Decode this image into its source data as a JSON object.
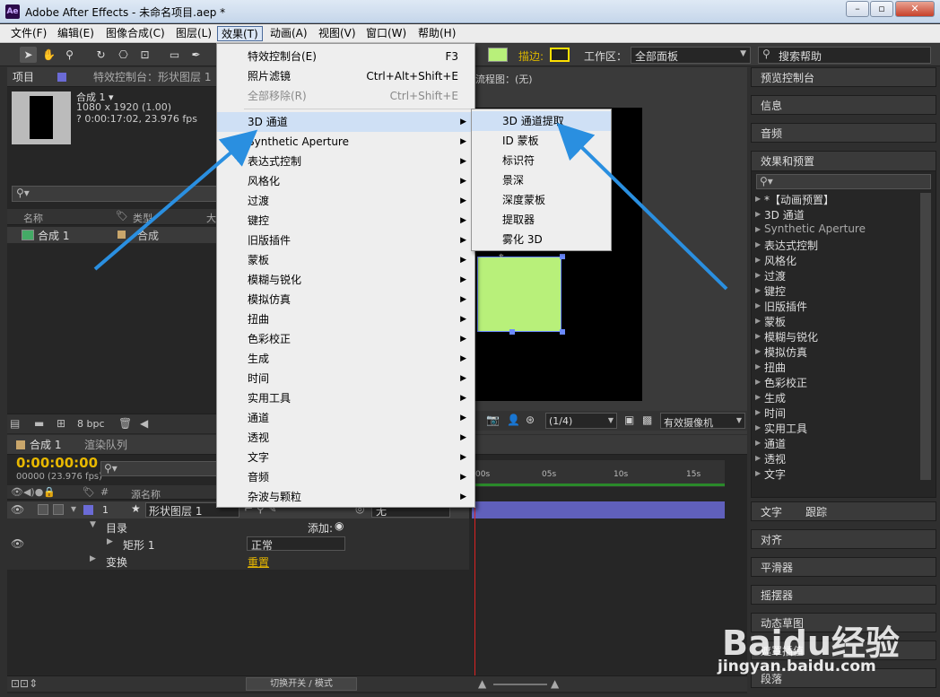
{
  "window": {
    "title": "Adobe After Effects - 未命名项目.aep *",
    "app_icon": "Ae"
  },
  "menubar": [
    "文件(F)",
    "编辑(E)",
    "图像合成(C)",
    "图层(L)",
    "效果(T)",
    "动画(A)",
    "视图(V)",
    "窗口(W)",
    "帮助(H)"
  ],
  "toolbar": {
    "stroke_label": "描边:",
    "workspace_label": "工作区：",
    "workspace_value": "全部面板",
    "search_placeholder": "搜索帮助",
    "fill_color": "#b8f07a",
    "stroke_color": "#ffff00"
  },
  "project_panel": {
    "tab": "项目",
    "effects_tab": "特效控制台：形状图层 1",
    "comp_name": "合成 1 ▾",
    "comp_dims": "1080 x 1920 (1.00)",
    "comp_time": "? 0:00:17:02, 23.976 fps",
    "col_name": "名称",
    "col_type": "类型",
    "col_size": "大",
    "item_name": "合成 1",
    "item_type": "合成",
    "bpc": "8 bpc"
  },
  "comp_panel": {
    "header": "流程图：(无)",
    "resolution": "(1/4)",
    "camera": "有效摄像机",
    "layer_color": "#b8f07a"
  },
  "effects_menu": {
    "items": [
      {
        "label": "特效控制台(E)",
        "shortcut": "F3"
      },
      {
        "label": "照片滤镜",
        "shortcut": "Ctrl+Alt+Shift+E"
      },
      {
        "label": "全部移除(R)",
        "shortcut": "Ctrl+Shift+E"
      },
      {
        "label": "3D 通道"
      },
      {
        "label": "Synthetic Aperture"
      },
      {
        "label": "表达式控制"
      },
      {
        "label": "风格化"
      },
      {
        "label": "过渡"
      },
      {
        "label": "键控"
      },
      {
        "label": "旧版插件"
      },
      {
        "label": "蒙板"
      },
      {
        "label": "模糊与锐化"
      },
      {
        "label": "模拟仿真"
      },
      {
        "label": "扭曲"
      },
      {
        "label": "色彩校正"
      },
      {
        "label": "生成"
      },
      {
        "label": "时间"
      },
      {
        "label": "实用工具"
      },
      {
        "label": "通道"
      },
      {
        "label": "透视"
      },
      {
        "label": "文字"
      },
      {
        "label": "音频"
      },
      {
        "label": "杂波与颗粒"
      }
    ]
  },
  "submenu_3d": [
    "3D 通道提取",
    "ID 蒙板",
    "标识符",
    "景深",
    "深度蒙板",
    "提取器",
    "雾化 3D"
  ],
  "right_panels": {
    "preview": "预览控制台",
    "info": "信息",
    "audio": "音频",
    "effects_presets": "效果和预置",
    "presets_list": [
      "*【动画预置】",
      "3D 通道",
      "Synthetic Aperture",
      "表达式控制",
      "风格化",
      "过渡",
      "键控",
      "旧版插件",
      "蒙板",
      "模糊与锐化",
      "模拟仿真",
      "扭曲",
      "色彩校正",
      "生成",
      "时间",
      "实用工具",
      "通道",
      "透视",
      "文字"
    ],
    "text": "文字",
    "tracker": "跟踪",
    "align": "对齐",
    "smoother": "平滑器",
    "wiggler": "摇摆器",
    "motion_sketch": "动态草图",
    "mask_interp": "遮罩插值",
    "paragraph": "段落"
  },
  "timeline": {
    "tab_comp": "合成 1",
    "tab_render": "渲染队列",
    "timecode": "0:00:00:00",
    "frames": "00000 (23.976 fps)",
    "col_source": "源名称",
    "layer_num": "1",
    "layer_name": "形状图层 1",
    "parent_none": "无",
    "contents": "目录",
    "add": "添加:",
    "rect": "矩形 1",
    "blend": "正常",
    "transform": "变换",
    "reset": "重置",
    "ruler": [
      "00s",
      "05s",
      "10s",
      "15s"
    ],
    "footer": "切换开关 / 模式",
    "layer_color": "#6b6bd6"
  },
  "watermark": {
    "brand": "Baidu经验",
    "url": "jingyan.baidu.com"
  }
}
